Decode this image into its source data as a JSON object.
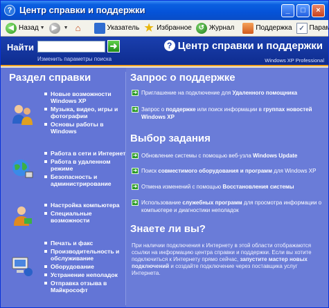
{
  "window": {
    "title": "Центр справки и поддержки",
    "controls": {
      "minimize": "_",
      "maximize": "□",
      "close": "×"
    }
  },
  "toolbar": {
    "back": "Назад",
    "index": "Указатель",
    "favorites": "Избранное",
    "history": "Журнал",
    "support": "Поддержка",
    "options": "Параметры"
  },
  "search": {
    "label": "Найти",
    "value": "",
    "options_link": "Изменить параметры поиска"
  },
  "header": {
    "title": "Центр справки и поддержки",
    "subtitle": "Windows XP Professional"
  },
  "left": {
    "heading": "Раздел справки",
    "groups": [
      {
        "icon": "people-icon",
        "items": [
          "Новые возможности Windows XP",
          "Музыка, видео, игры и фотографии",
          "Основы работы в Windows"
        ]
      },
      {
        "icon": "network-globe-icon",
        "items": [
          "Работа в сети и Интернет",
          "Работа в удаленном режиме",
          "Безопасность и администрирование"
        ]
      },
      {
        "icon": "user-settings-icon",
        "items": [
          "Настройка компьютера",
          "Специальные возможности"
        ]
      },
      {
        "icon": "computer-help-icon",
        "items": [
          "Печать и факс",
          "Производительность и обслуживание",
          "Оборудование",
          "Устранение неполадок",
          "Отправка отзыва в Майкрософт"
        ]
      }
    ]
  },
  "right": {
    "support_heading": "Запрос о поддержке",
    "support_tasks": [
      {
        "pre": "Приглашение на подключение для ",
        "bold": "Удаленного помощника",
        "post": ""
      },
      {
        "pre": "Запрос о ",
        "bold": "поддержке",
        "post": " или поиск информации в ",
        "bold2": "группах новостей Windows XP"
      }
    ],
    "tasks_heading": "Выбор задания",
    "tasks": [
      {
        "pre": "Обновление системы с помощью веб-узла ",
        "bold": "Windows Update",
        "post": ""
      },
      {
        "pre": "Поиск ",
        "bold": "совместимого оборудования и программ",
        "post": " для Windows XP"
      },
      {
        "pre": "Отмена изменений с помощью ",
        "bold": "Восстановления системы",
        "post": ""
      },
      {
        "pre": "Использование ",
        "bold": "служебных программ",
        "post": " для просмотра информации о компьютере и диагностики неполадок"
      }
    ],
    "know_heading": "Знаете ли вы?",
    "know_text_1": "При наличии подключения к Интернету в этой области отображаются ссылки на информацию центра справки и поддержки. Если вы хотите подключиться к Интернету прямо сейчас, ",
    "know_bold_1": "запустите мастер новых подключений",
    "know_text_2": " и создайте подключение через поставщика услуг Интернета."
  },
  "colors": {
    "title_bar": "#0553d8",
    "search_band": "#1a3fae",
    "content_bg": "#6375d6",
    "accent_line": "#f0a020",
    "arrow_green": "#2c9a2a"
  }
}
